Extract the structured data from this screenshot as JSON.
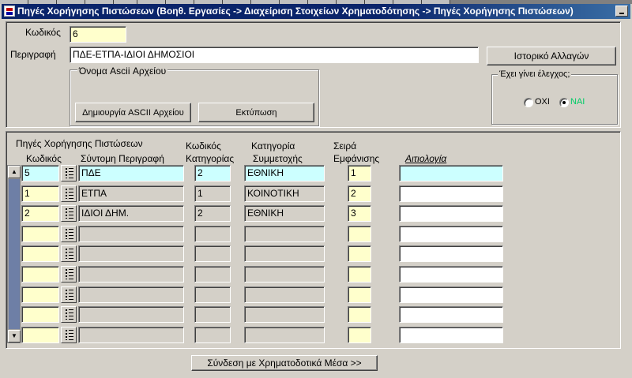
{
  "window": {
    "title": "Πηγές Χορήγησης Πιστώσεων (Βοηθ. Εργασίες -> Διαχείριση Στοιχείων Χρηματοδότησης -> Πηγές Χορήγησης Πιστώσεων)"
  },
  "header": {
    "code_label": "Κωδικός",
    "code_value": "6",
    "description_label": "Περιγραφή",
    "description_value": "ΠΔΕ-ΕΤΠΑ-ΙΔΙΟΙ ΔΗΜΟΣΙΟΙ",
    "history_button": "Ιστορικό Αλλαγών",
    "ascii_group_title": "Όνομα Ascii Αρχείου",
    "create_ascii_button": "Δημιουργία ASCII Αρχείου",
    "print_button": "Εκτύπωση",
    "checked_group_title": "Έχει γίνει έλεγχος;",
    "radio_no_label": "ΟΧΙ",
    "radio_yes_label": "ΝΑΙ",
    "radio_selected": "yes"
  },
  "grid": {
    "title": "Πηγές Χορήγησης Πιστώσεων",
    "columns": {
      "code": "Κωδικός",
      "short_desc": "Σύντομη Περιγραφή",
      "category_code_line1": "Κωδικός",
      "category_code_line2": "Κατηγορίας",
      "participation_line1": "Κατηγορία",
      "participation_line2": "Συμμετοχής",
      "order_line1": "Σειρά",
      "order_line2": "Εμφάνισης",
      "justification": "Αιτιολογία"
    },
    "rows": [
      {
        "code": "5",
        "short_desc": "ΠΔΕ",
        "category_code": "2",
        "participation": "ΕΘΝΙΚΗ",
        "order": "1",
        "justification": ""
      },
      {
        "code": "1",
        "short_desc": "ΕΤΠΑ",
        "category_code": "1",
        "participation": "ΚΟΙΝΟΤΙΚΗ",
        "order": "2",
        "justification": ""
      },
      {
        "code": "2",
        "short_desc": "ΙΔΙΟΙ ΔΗΜ.",
        "category_code": "2",
        "participation": "ΕΘΝΙΚΗ",
        "order": "3",
        "justification": ""
      },
      {
        "code": "",
        "short_desc": "",
        "category_code": "",
        "participation": "",
        "order": "",
        "justification": ""
      },
      {
        "code": "",
        "short_desc": "",
        "category_code": "",
        "participation": "",
        "order": "",
        "justification": ""
      },
      {
        "code": "",
        "short_desc": "",
        "category_code": "",
        "participation": "",
        "order": "",
        "justification": ""
      },
      {
        "code": "",
        "short_desc": "",
        "category_code": "",
        "participation": "",
        "order": "",
        "justification": ""
      },
      {
        "code": "",
        "short_desc": "",
        "category_code": "",
        "participation": "",
        "order": "",
        "justification": ""
      },
      {
        "code": "",
        "short_desc": "",
        "category_code": "",
        "participation": "",
        "order": "",
        "justification": ""
      }
    ]
  },
  "footer": {
    "link_button": "Σύνδεση με Χρηματοδοτικά Μέσα >>"
  },
  "colors": {
    "titlebar": "#0a246a",
    "current_row": "#ccffff",
    "required_field": "#ffffcc",
    "radio_yes_text": "#00cc66"
  }
}
